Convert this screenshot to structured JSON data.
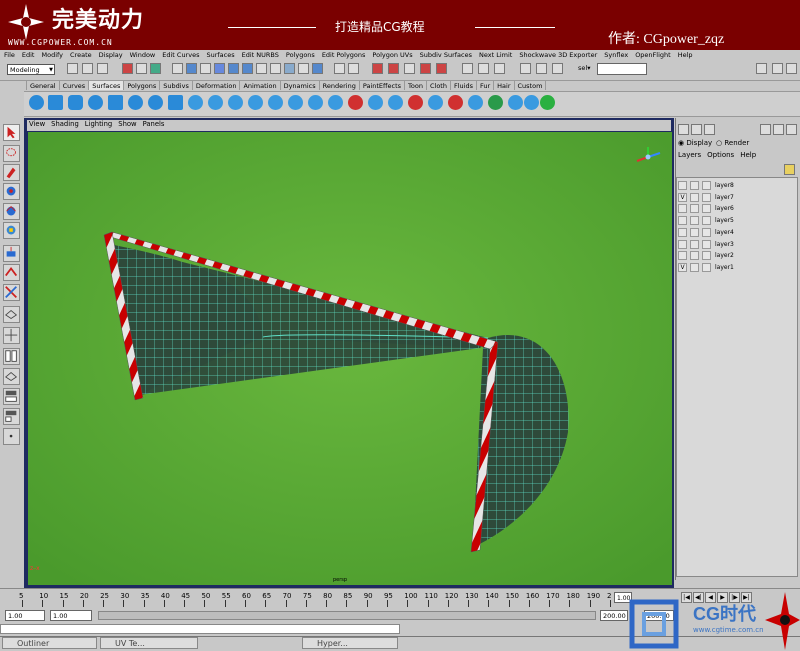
{
  "banner": {
    "logo_text": "完美动力",
    "logo_url": "WWW.CGPOWER.COM.CN",
    "title": "打造精品CG教程",
    "author": "作者: CGpower_zqz"
  },
  "menubar": [
    "File",
    "Edit",
    "Modify",
    "Create",
    "Display",
    "Window",
    "Edit Curves",
    "Surfaces",
    "Edit NURBS",
    "Polygons",
    "Edit Polygons",
    "Polygon UVs",
    "Subdiv Surfaces",
    "Next Limit",
    "Shockwave 3D Exporter",
    "Synflex",
    "OpenFlight",
    "Help"
  ],
  "status": {
    "mode": "Modeling",
    "sel_label": "sel▾",
    "sel_value": ""
  },
  "shelf": {
    "tabs": [
      "General",
      "Curves",
      "Surfaces",
      "Polygons",
      "Subdivs",
      "Deformation",
      "Animation",
      "Dynamics",
      "Rendering",
      "PaintEffects",
      "Toon",
      "Cloth",
      "Fluids",
      "Fur",
      "Hair",
      "Custom"
    ],
    "active_tab": "Surfaces"
  },
  "viewport": {
    "menu": [
      "View",
      "Shading",
      "Lighting",
      "Show",
      "Panels"
    ],
    "camera_label": "persp",
    "axis_label": "z–x",
    "bg_color": "#5fa63a"
  },
  "layers": {
    "radio_display": "Display",
    "radio_render": "Render",
    "menu": [
      "Layers",
      "Options",
      "Help"
    ],
    "items": [
      {
        "name": "layer8",
        "visible": ""
      },
      {
        "name": "layer7",
        "visible": "V"
      },
      {
        "name": "layer6",
        "visible": ""
      },
      {
        "name": "layer5",
        "visible": ""
      },
      {
        "name": "layer4",
        "visible": ""
      },
      {
        "name": "layer3",
        "visible": ""
      },
      {
        "name": "layer2",
        "visible": ""
      },
      {
        "name": "layer1",
        "visible": "V"
      }
    ]
  },
  "timeline": {
    "ticks": [
      "5",
      "10",
      "15",
      "20",
      "25",
      "30",
      "35",
      "40",
      "45",
      "50",
      "55",
      "60",
      "65",
      "70",
      "75",
      "80",
      "85",
      "90",
      "95",
      "100",
      "110",
      "120",
      "130",
      "140",
      "150",
      "160",
      "170",
      "180",
      "190",
      "2"
    ],
    "current": "1.00",
    "range_start": "1.00",
    "range_start2": "1.00",
    "range_end": "200.00",
    "range_end2": "200.00"
  },
  "taskbar": {
    "items": [
      "Outliner",
      "UV Te...",
      "Hyper..."
    ]
  },
  "watermark": {
    "text": "CG时代",
    "url": "www.cgtime.com.cn"
  }
}
